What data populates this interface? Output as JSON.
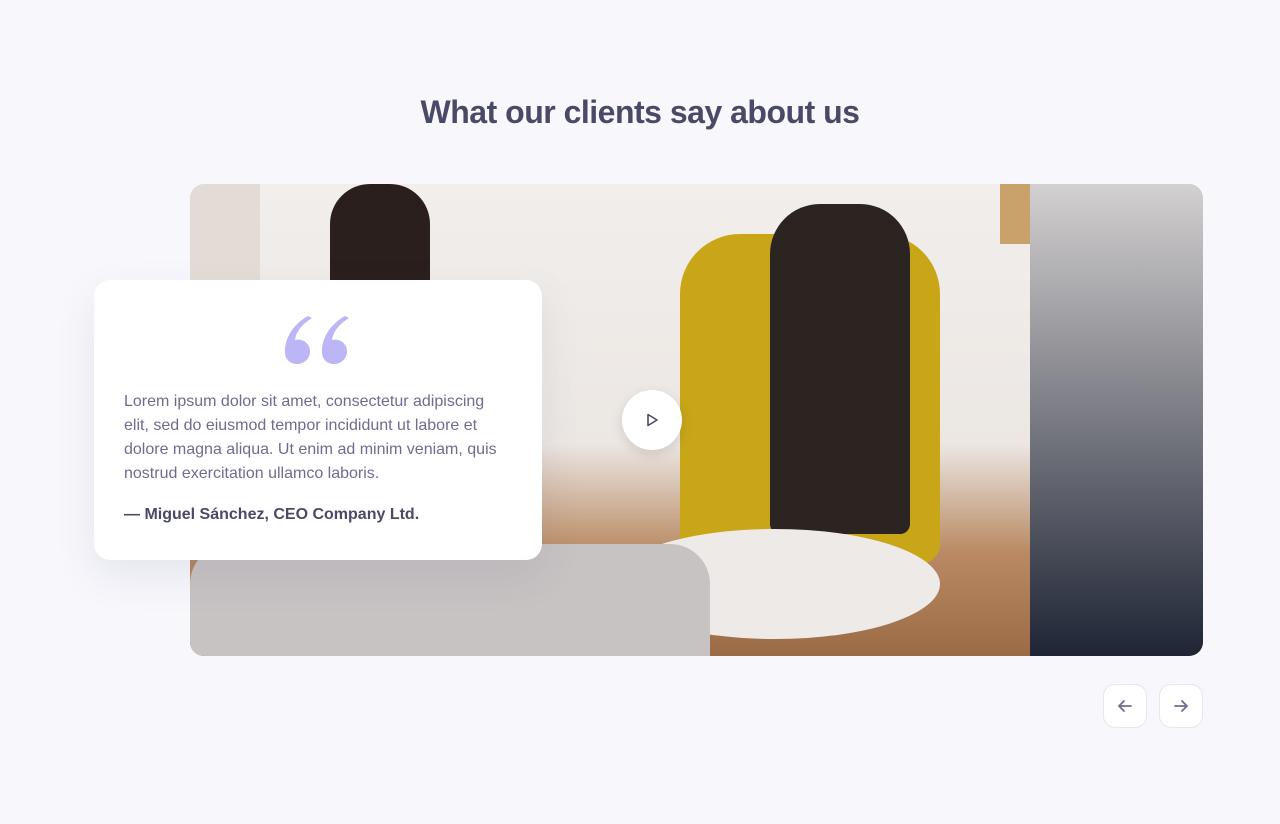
{
  "section": {
    "title": "What our clients say about us"
  },
  "testimonial": {
    "quote": "Lorem ipsum dolor sit amet, consectetur adipiscing elit, sed do eiusmod tempor incididunt ut labore et dolore magna aliqua. Ut enim ad minim veniam, quis nostrud exercitation ullamco laboris.",
    "author": "— Miguel Sánchez, CEO Company Ltd.",
    "quote_icon": "quote-mark-icon",
    "accent_color": "#bcb6f6"
  },
  "video": {
    "play_icon": "play-icon"
  },
  "navigation": {
    "prev_icon": "arrow-left-icon",
    "next_icon": "arrow-right-icon"
  },
  "colors": {
    "background": "#f7f7fc",
    "heading": "#4a4a68",
    "body_text": "#6f6c90"
  }
}
